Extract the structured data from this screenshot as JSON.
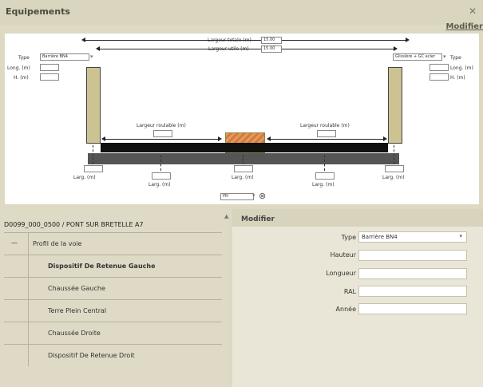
{
  "window": {
    "title": "Equipements",
    "modify_link": "Modifier"
  },
  "diagram": {
    "largeur_totale_label": "Largeur totale (m)",
    "largeur_totale_value": "15.00",
    "largeur_utile_label": "Largeur utile (m)",
    "largeur_utile_value": "15.00",
    "left_type_label": "Type",
    "left_type_value": "Barrière BN4",
    "right_type_label": "Type",
    "right_type_value": "Glissière + GC acier",
    "long_label": "Long. (m)",
    "h_label": "H. (m)",
    "roulable_label": "Largeur roulable (m)",
    "larg_label": "Larg. (m)",
    "pr_value": "PR-"
  },
  "tree": {
    "breadcrumb": "D0099_000_0500 / PONT SUR BRETELLE A7",
    "items": [
      {
        "label": "Profil de la voie",
        "bold": false
      },
      {
        "label": "Dispositif De Retenue Gauche",
        "bold": true
      },
      {
        "label": "Chaussée Gauche",
        "bold": false
      },
      {
        "label": "Terre Plein Central",
        "bold": false
      },
      {
        "label": "Chaussée Droite",
        "bold": false
      },
      {
        "label": "Dispositif De Retenue Droit",
        "bold": false
      }
    ],
    "collapse_symbol": "—"
  },
  "form": {
    "title": "Modifier",
    "type_label": "Type",
    "type_value": "Barrière BN4",
    "hauteur_label": "Hauteur",
    "longueur_label": "Longueur",
    "ral_label": "RAL",
    "annee_label": "Année"
  },
  "icons": [
    "close-icon",
    "dropdown-arrow-icon",
    "clear-icon",
    "scroll-up-icon"
  ]
}
